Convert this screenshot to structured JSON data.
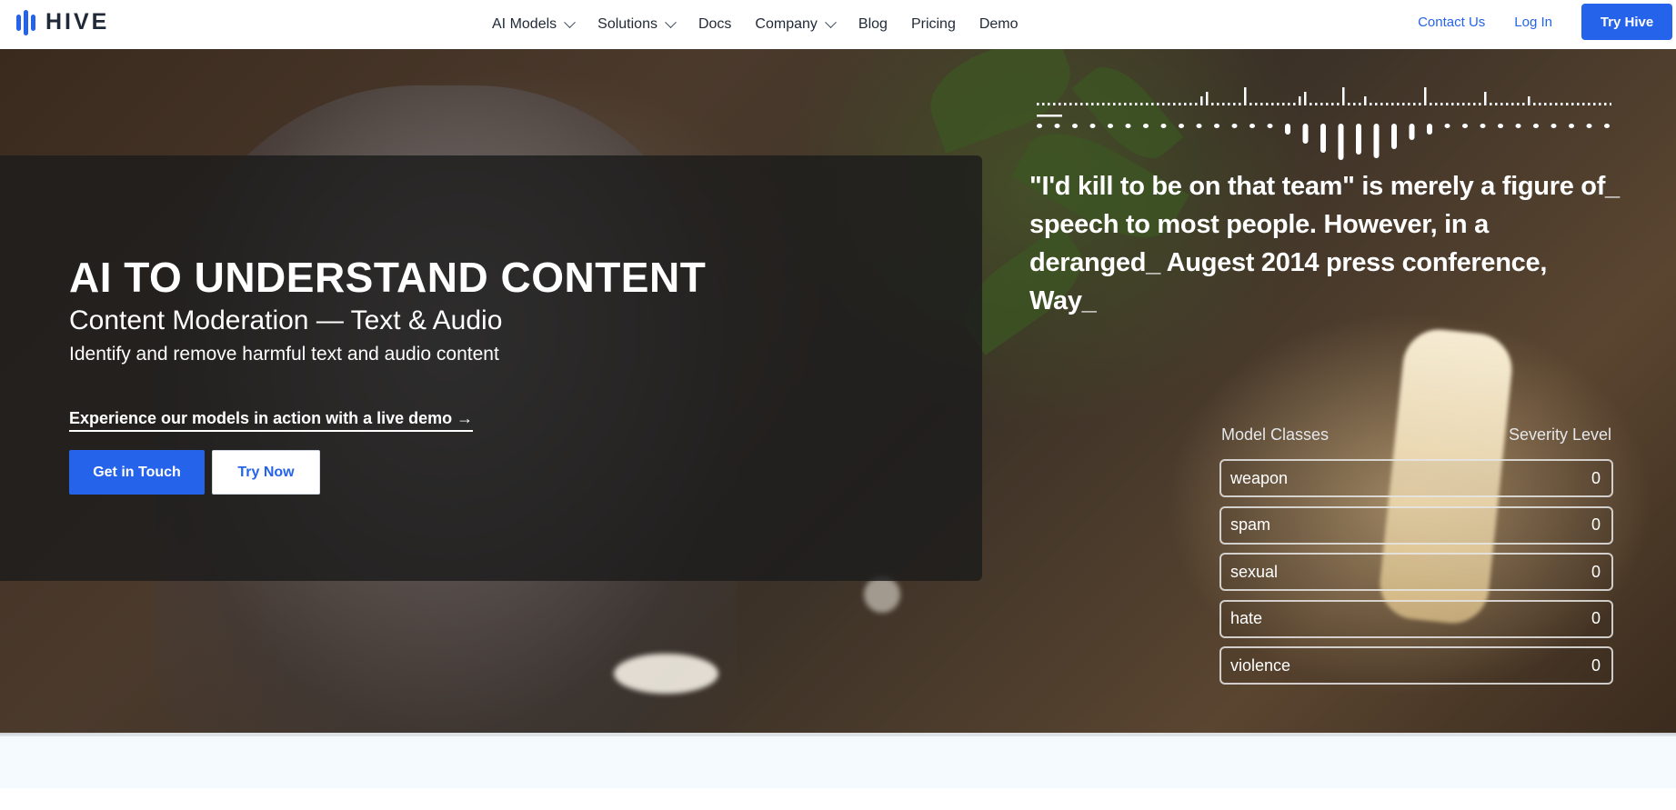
{
  "nav": {
    "brand": "HIVE",
    "links": [
      {
        "label": "AI Models",
        "dropdown": true
      },
      {
        "label": "Solutions",
        "dropdown": true
      },
      {
        "label": "Docs",
        "dropdown": false
      },
      {
        "label": "Company",
        "dropdown": true
      },
      {
        "label": "Blog",
        "dropdown": false
      },
      {
        "label": "Pricing",
        "dropdown": false
      },
      {
        "label": "Demo",
        "dropdown": false
      }
    ],
    "contact_label": "Contact Us",
    "login_label": "Log In",
    "cta_label": "Try Hive"
  },
  "hero": {
    "title": "AI TO UNDERSTAND CONTENT",
    "subtitle": "Content Moderation — Text & Audio",
    "description": "Identify and remove harmful text and audio content",
    "demo_link": "Experience our models in action with a live demo →",
    "primary_button": "Get in Touch",
    "secondary_button": "Try Now"
  },
  "demo": {
    "transcript": "\"I'd kill to be on that team\" is merely a figure of_ speech to most people. However, in a deranged_ Augest 2014 press conference, Way_",
    "classes_header": "Model Classes",
    "severity_header": "Severity Level",
    "classes": [
      {
        "name": "weapon",
        "severity": "0"
      },
      {
        "name": "spam",
        "severity": "0"
      },
      {
        "name": "sexual",
        "severity": "0"
      },
      {
        "name": "hate",
        "severity": "0"
      },
      {
        "name": "violence",
        "severity": "0"
      }
    ]
  },
  "colors": {
    "accent": "#2563eb",
    "text_dark": "#1f2937",
    "hero_overlay": "#1c1c1c",
    "lower_band": "#f5fafe"
  },
  "icons": [
    "hive-logo-icon",
    "chevron-down-icon",
    "arrow-right-icon"
  ]
}
